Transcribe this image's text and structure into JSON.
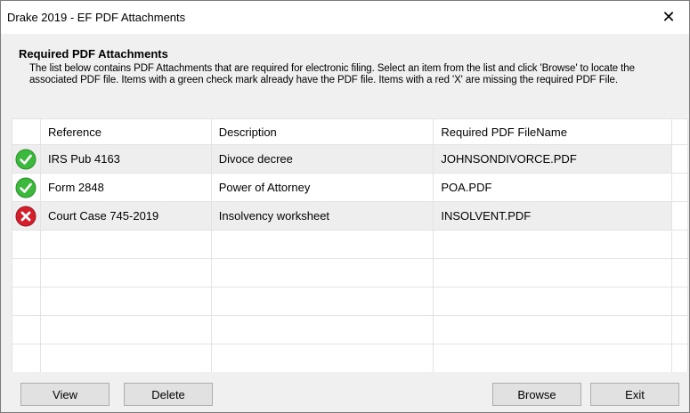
{
  "window": {
    "title": "Drake 2019 - EF PDF Attachments",
    "close_symbol": "✕"
  },
  "header": {
    "title": "Required PDF Attachments",
    "description": "The list below contains PDF Attachments that are required for electronic filing. Select an item from the list and click 'Browse' to locate the associated PDF file. Items with a green check mark already have the PDF file. Items with a red 'X' are missing the required PDF File."
  },
  "table": {
    "columns": [
      "",
      "Reference",
      "Description",
      "Required PDF FileName"
    ],
    "rows": [
      {
        "status": "check-icon",
        "reference": "IRS Pub 4163",
        "description": "Divoce decree",
        "filename": "JOHNSONDIVORCE.PDF"
      },
      {
        "status": "check-icon",
        "reference": "Form 2848",
        "description": "Power of Attorney",
        "filename": "POA.PDF"
      },
      {
        "status": "x-icon",
        "reference": "Court Case 745-2019",
        "description": "Insolvency worksheet",
        "filename": "INSOLVENT.PDF"
      }
    ]
  },
  "buttons": {
    "view": "View",
    "delete": "Delete",
    "browse": "Browse",
    "exit": "Exit"
  },
  "colors": {
    "check_green": "#3cb83c",
    "x_red": "#d21f2b"
  }
}
